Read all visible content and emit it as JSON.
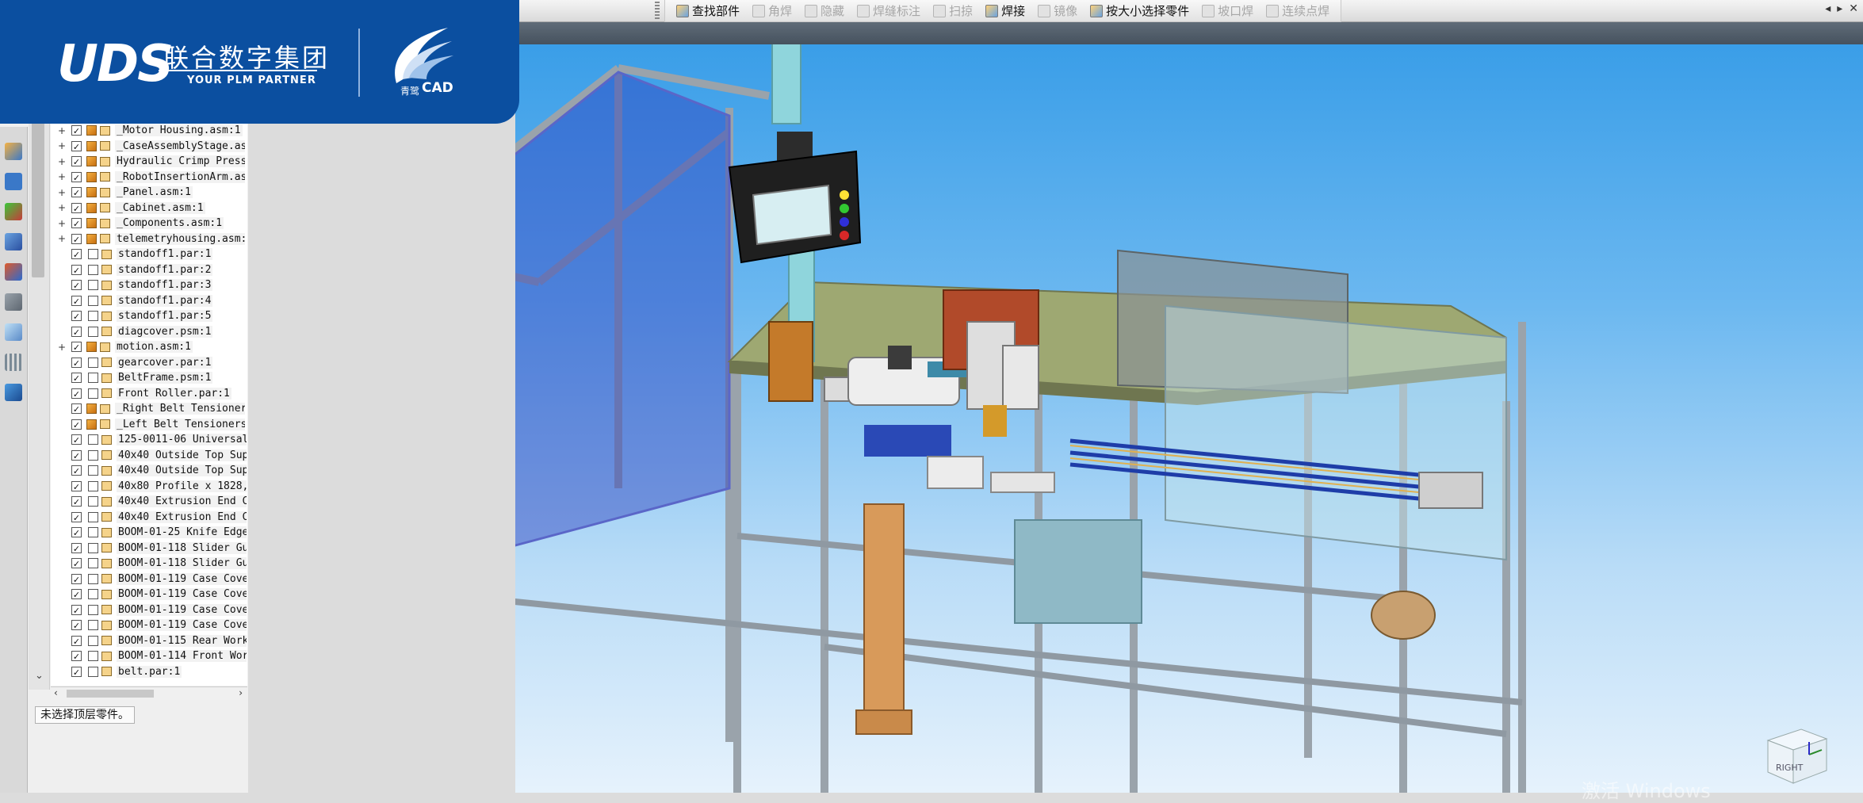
{
  "toolbar": {
    "buttons": [
      {
        "label": "查找部件",
        "enabled": true
      },
      {
        "label": "角焊",
        "enabled": false
      },
      {
        "label": "隐藏",
        "enabled": false
      },
      {
        "label": "焊缝标注",
        "enabled": false
      },
      {
        "label": "扫掠",
        "enabled": false
      },
      {
        "label": "焊接",
        "enabled": true
      },
      {
        "label": "镜像",
        "enabled": false
      },
      {
        "label": "按大小选择零件",
        "enabled": true
      },
      {
        "label": "坡口焊",
        "enabled": false
      },
      {
        "label": "连续点焊",
        "enabled": false
      }
    ],
    "window_controls": {
      "prev": "◂",
      "next": "▸",
      "close": "✕"
    }
  },
  "logo": {
    "brand": "UDS",
    "company_cn": "联合数字集团",
    "tagline": "YOUR PLM PARTNER",
    "product_prefix": "青鹭",
    "product": "CAD"
  },
  "tree": {
    "items": [
      {
        "label": "_Motor Housing.asm:1",
        "type": "asm",
        "expand": "+",
        "checked": true
      },
      {
        "label": "_CaseAssemblyStage.as",
        "type": "asm",
        "expand": "+",
        "checked": true
      },
      {
        "label": "Hydraulic Crimp Press",
        "type": "asm",
        "expand": "+",
        "checked": true
      },
      {
        "label": "_RobotInsertionArm.as",
        "type": "asm",
        "expand": "+",
        "checked": true
      },
      {
        "label": "_Panel.asm:1",
        "type": "asm",
        "expand": "+",
        "checked": true
      },
      {
        "label": "_Cabinet.asm:1",
        "type": "asm",
        "expand": "+",
        "checked": true
      },
      {
        "label": "_Components.asm:1",
        "type": "asm",
        "expand": "+",
        "checked": true
      },
      {
        "label": "telemetryhousing.asm:",
        "type": "asm",
        "expand": "+",
        "checked": true
      },
      {
        "label": "standoff1.par:1",
        "type": "par",
        "expand": "",
        "checked": true
      },
      {
        "label": "standoff1.par:2",
        "type": "par",
        "expand": "",
        "checked": true
      },
      {
        "label": "standoff1.par:3",
        "type": "par",
        "expand": "",
        "checked": true
      },
      {
        "label": "standoff1.par:4",
        "type": "par",
        "expand": "",
        "checked": true
      },
      {
        "label": "standoff1.par:5",
        "type": "par",
        "expand": "",
        "checked": true
      },
      {
        "label": "diagcover.psm:1",
        "type": "psm",
        "expand": "",
        "checked": true
      },
      {
        "label": "motion.asm:1",
        "type": "asm",
        "expand": "+",
        "checked": true
      },
      {
        "label": "gearcover.par:1",
        "type": "psm",
        "expand": "",
        "checked": true
      },
      {
        "label": "BeltFrame.psm:1",
        "type": "psm",
        "expand": "",
        "checked": true
      },
      {
        "label": "Front Roller.par:1",
        "type": "par",
        "expand": "",
        "checked": true
      },
      {
        "label": "_Right Belt Tensioner",
        "type": "asm",
        "expand": "",
        "checked": true
      },
      {
        "label": "_Left Belt Tensioners",
        "type": "asm",
        "expand": "",
        "checked": true
      },
      {
        "label": "125-0011-06 Universal",
        "type": "par",
        "expand": "",
        "checked": true
      },
      {
        "label": "40x40 Outside Top Sup",
        "type": "par",
        "expand": "",
        "checked": true
      },
      {
        "label": "40x40 Outside Top Sup",
        "type": "par",
        "expand": "",
        "checked": true
      },
      {
        "label": "40x80 Profile x 1828,",
        "type": "par",
        "expand": "",
        "checked": true
      },
      {
        "label": "40x40 Extrusion End C",
        "type": "par",
        "expand": "",
        "checked": true
      },
      {
        "label": "40x40 Extrusion End C",
        "type": "par",
        "expand": "",
        "checked": true
      },
      {
        "label": "BOOM-01-25 Knife Edge",
        "type": "psm",
        "expand": "",
        "checked": true
      },
      {
        "label": "BOOM-01-118 Slider Gu",
        "type": "par",
        "expand": "",
        "checked": true
      },
      {
        "label": "BOOM-01-118 Slider Gu",
        "type": "par",
        "expand": "",
        "checked": true
      },
      {
        "label": "BOOM-01-119 Case Cove",
        "type": "par",
        "expand": "",
        "checked": true
      },
      {
        "label": "BOOM-01-119 Case Cove",
        "type": "par",
        "expand": "",
        "checked": true
      },
      {
        "label": "BOOM-01-119 Case Cove",
        "type": "par",
        "expand": "",
        "checked": true
      },
      {
        "label": "BOOM-01-119 Case Cove",
        "type": "par",
        "expand": "",
        "checked": true
      },
      {
        "label": "BOOM-01-115 Rear Work",
        "type": "par",
        "expand": "",
        "checked": true
      },
      {
        "label": "BOOM-01-114 Front Wor",
        "type": "par",
        "expand": "",
        "checked": true
      },
      {
        "label": "belt.par:1",
        "type": "psm",
        "expand": "",
        "checked": true
      }
    ]
  },
  "status": {
    "text": "未选择顶层零件。"
  },
  "viewcube": {
    "label": "RIGHT"
  },
  "watermark": {
    "text": "激活 Windows"
  },
  "colors": {
    "logo_bg": "#0b4fa0",
    "viewport_top": "#3a9ee8",
    "viewport_bottom": "#e6f2fc"
  }
}
